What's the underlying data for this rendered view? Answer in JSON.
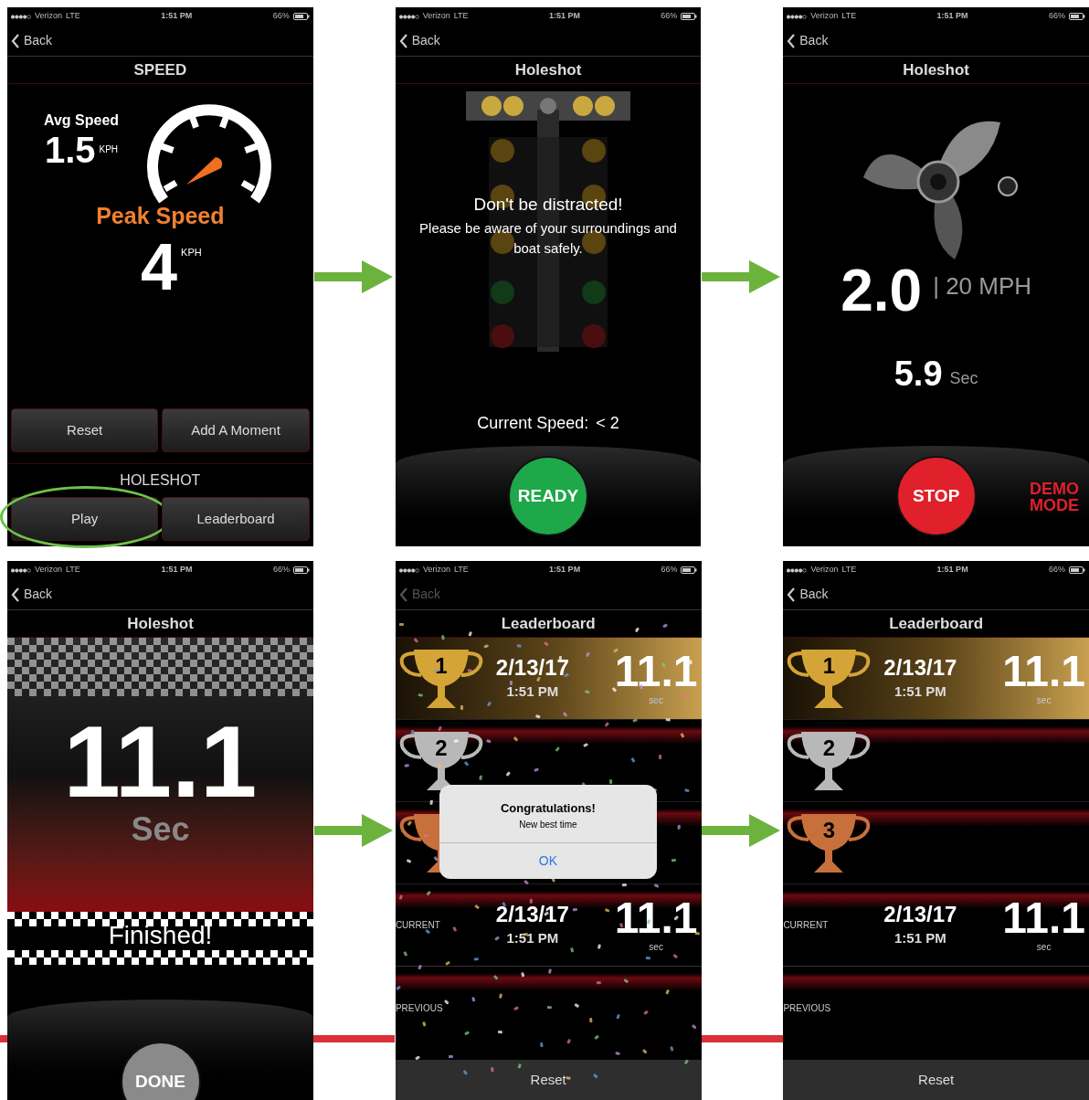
{
  "screens": [
    {
      "kind": "speed",
      "status": {
        "carrier": "Verizon",
        "network": "LTE",
        "time": "1:51 PM",
        "battery": "66%"
      },
      "back": {
        "label": "Back",
        "disabled": false
      },
      "title": "SPEED",
      "avg": {
        "label": "Avg Speed",
        "value": "1.5",
        "unit": "KPH"
      },
      "peak": {
        "label": "Peak Speed",
        "value": "4",
        "unit": "KPH"
      },
      "buttons": [
        "Reset",
        "Add A Moment"
      ],
      "section": "HOLESHOT",
      "bottom_buttons": [
        {
          "label": "Play",
          "highlighted": true
        },
        {
          "label": "Leaderboard",
          "highlighted": false
        }
      ]
    },
    {
      "kind": "lights",
      "status": {
        "carrier": "Verizon",
        "network": "LTE",
        "time": "1:51 PM",
        "battery": "66%"
      },
      "back": {
        "label": "Back",
        "disabled": false
      },
      "title": "Holeshot",
      "warning_title": "Don't be distracted!",
      "warning_text": "Please be aware of your surroundings and boat safely.",
      "speed_label": "Current Speed:",
      "speed_value": "< 2",
      "action": {
        "label": "READY",
        "color": "#1fa84a"
      }
    },
    {
      "kind": "run",
      "status": {
        "carrier": "Verizon",
        "network": "LTE",
        "time": "1:51 PM",
        "battery": "66%"
      },
      "back": {
        "label": "Back",
        "disabled": false
      },
      "title": "Holeshot",
      "value": "2.0",
      "speed": "| 20 MPH",
      "elapsed": "5.9",
      "elapsed_unit": "Sec",
      "action": {
        "label": "STOP",
        "color": "#e0202a"
      },
      "demo": "DEMO MODE"
    },
    {
      "kind": "finish",
      "status": {
        "carrier": "Verizon",
        "network": "LTE",
        "time": "1:51 PM",
        "battery": "66%"
      },
      "back": {
        "label": "Back",
        "disabled": false
      },
      "title": "Holeshot",
      "value": "11.1",
      "unit": "Sec",
      "finished": "Finished!",
      "action": {
        "label": "DONE",
        "color": "#8a8a8a"
      }
    },
    {
      "kind": "leaderboard",
      "status": {
        "carrier": "Verizon",
        "network": "LTE",
        "time": "1:51 PM",
        "battery": "66%"
      },
      "back": {
        "label": "Back",
        "disabled": true
      },
      "confetti": true,
      "title": "Leaderboard",
      "rows": [
        {
          "rank": "1",
          "color": "#d4a437",
          "date": "2/13/17",
          "time": "1:51 PM",
          "score": "11.1",
          "unit": "sec"
        },
        {
          "rank": "2",
          "color": "#b8b8b8"
        },
        {
          "color": "#c8703c"
        }
      ],
      "current": {
        "label": "CURRENT",
        "date": "2/13/17",
        "time": "1:51 PM",
        "score": "11.1",
        "unit": "sec"
      },
      "previous": {
        "label": "PREVIOUS"
      },
      "reset": "Reset",
      "alert": {
        "title": "Congratulations!",
        "message": "New best time",
        "button": "OK"
      }
    },
    {
      "kind": "leaderboard",
      "status": {
        "carrier": "Verizon",
        "network": "LTE",
        "time": "1:51 PM",
        "battery": "66%"
      },
      "back": {
        "label": "Back",
        "disabled": false
      },
      "confetti": false,
      "title": "Leaderboard",
      "rows": [
        {
          "rank": "1",
          "color": "#d4a437",
          "date": "2/13/17",
          "time": "1:51 PM",
          "score": "11.1",
          "unit": "sec"
        },
        {
          "rank": "2",
          "color": "#b8b8b8"
        },
        {
          "rank": "3",
          "color": "#c8703c"
        }
      ],
      "current": {
        "label": "CURRENT",
        "date": "2/13/17",
        "time": "1:51 PM",
        "score": "11.1",
        "unit": "sec"
      },
      "previous": {
        "label": "PREVIOUS"
      },
      "reset": "Reset"
    }
  ]
}
